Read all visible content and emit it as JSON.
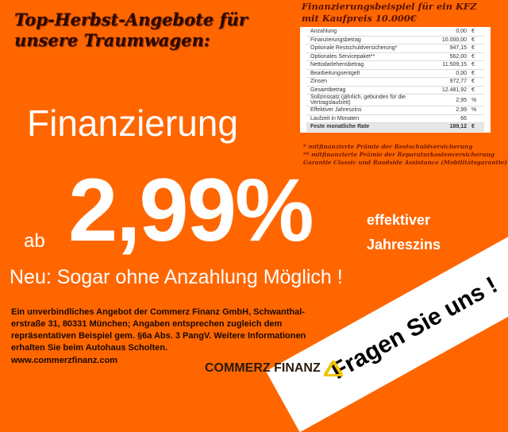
{
  "headline": [
    "Top-Herbst-Angebote für",
    "unsere Traumwagen:"
  ],
  "example_title": [
    "Finanzierungsbeispiel für ein KFZ",
    "mit Kaufpreis 10.000€"
  ],
  "table": [
    {
      "label": "Anzahlung",
      "value": "0,00",
      "unit": "€"
    },
    {
      "label": "Finanzierungsbetrag",
      "value": "10.000,00",
      "unit": "€"
    },
    {
      "label": "Optionale Restschuldversicherung*",
      "value": "947,15",
      "unit": "€"
    },
    {
      "label": "Optionales Servicepaket**",
      "value": "562,00",
      "unit": "€"
    },
    {
      "label": "Nettodarlehensbetrag",
      "value": "11.509,15",
      "unit": "€"
    },
    {
      "label": "Bearbeitungsentgelt",
      "value": "0,00",
      "unit": "€"
    },
    {
      "label": "Zinsen",
      "value": "972,77",
      "unit": "€"
    },
    {
      "label": "Gesamtbetrag",
      "value": "12.481,92",
      "unit": "€"
    },
    {
      "label": "Sollzinssatz (jährlich, gebunden für die Vertragslaufzeit)",
      "value": "2,95",
      "unit": "%"
    },
    {
      "label": "Effektiver Jahreszins",
      "value": "2,99",
      "unit": "%"
    },
    {
      "label": "Laufzeit in Monaten",
      "value": "66",
      "unit": ""
    },
    {
      "label": "Feste monatliche Rate",
      "value": "189,12",
      "unit": "€"
    }
  ],
  "notes": [
    "* mitfinanzierte Prämie der Restschuldversicherung",
    "** mitfinanzierte Prämie der Reparaturkostenversicherung",
    "Garantie Classic und Roadside Assistance (Mobilitätsgarantie)"
  ],
  "finanzierung": "Finanzierung",
  "ab": "ab",
  "rate": "2,99%",
  "effektiver": "effektiver",
  "jahreszins": "Jahreszins",
  "neu": "Neu: Sogar ohne Anzahlung Möglich !",
  "disclaimer": "Ein unverbindliches Angebot der Commerz Finanz GmbH, Schwanthal-erstraße 31, 80331 München; Angaben entsprechen zugleich dem repräsentativen Beispiel gem. §6a Abs. 3 PangV. Weitere Informationen erhalten Sie beim Autohaus Scholten.",
  "url": "www.commerzfinanz.com",
  "logo": "COMMERZ FINANZ",
  "banner": "Fragen Sie uns !"
}
